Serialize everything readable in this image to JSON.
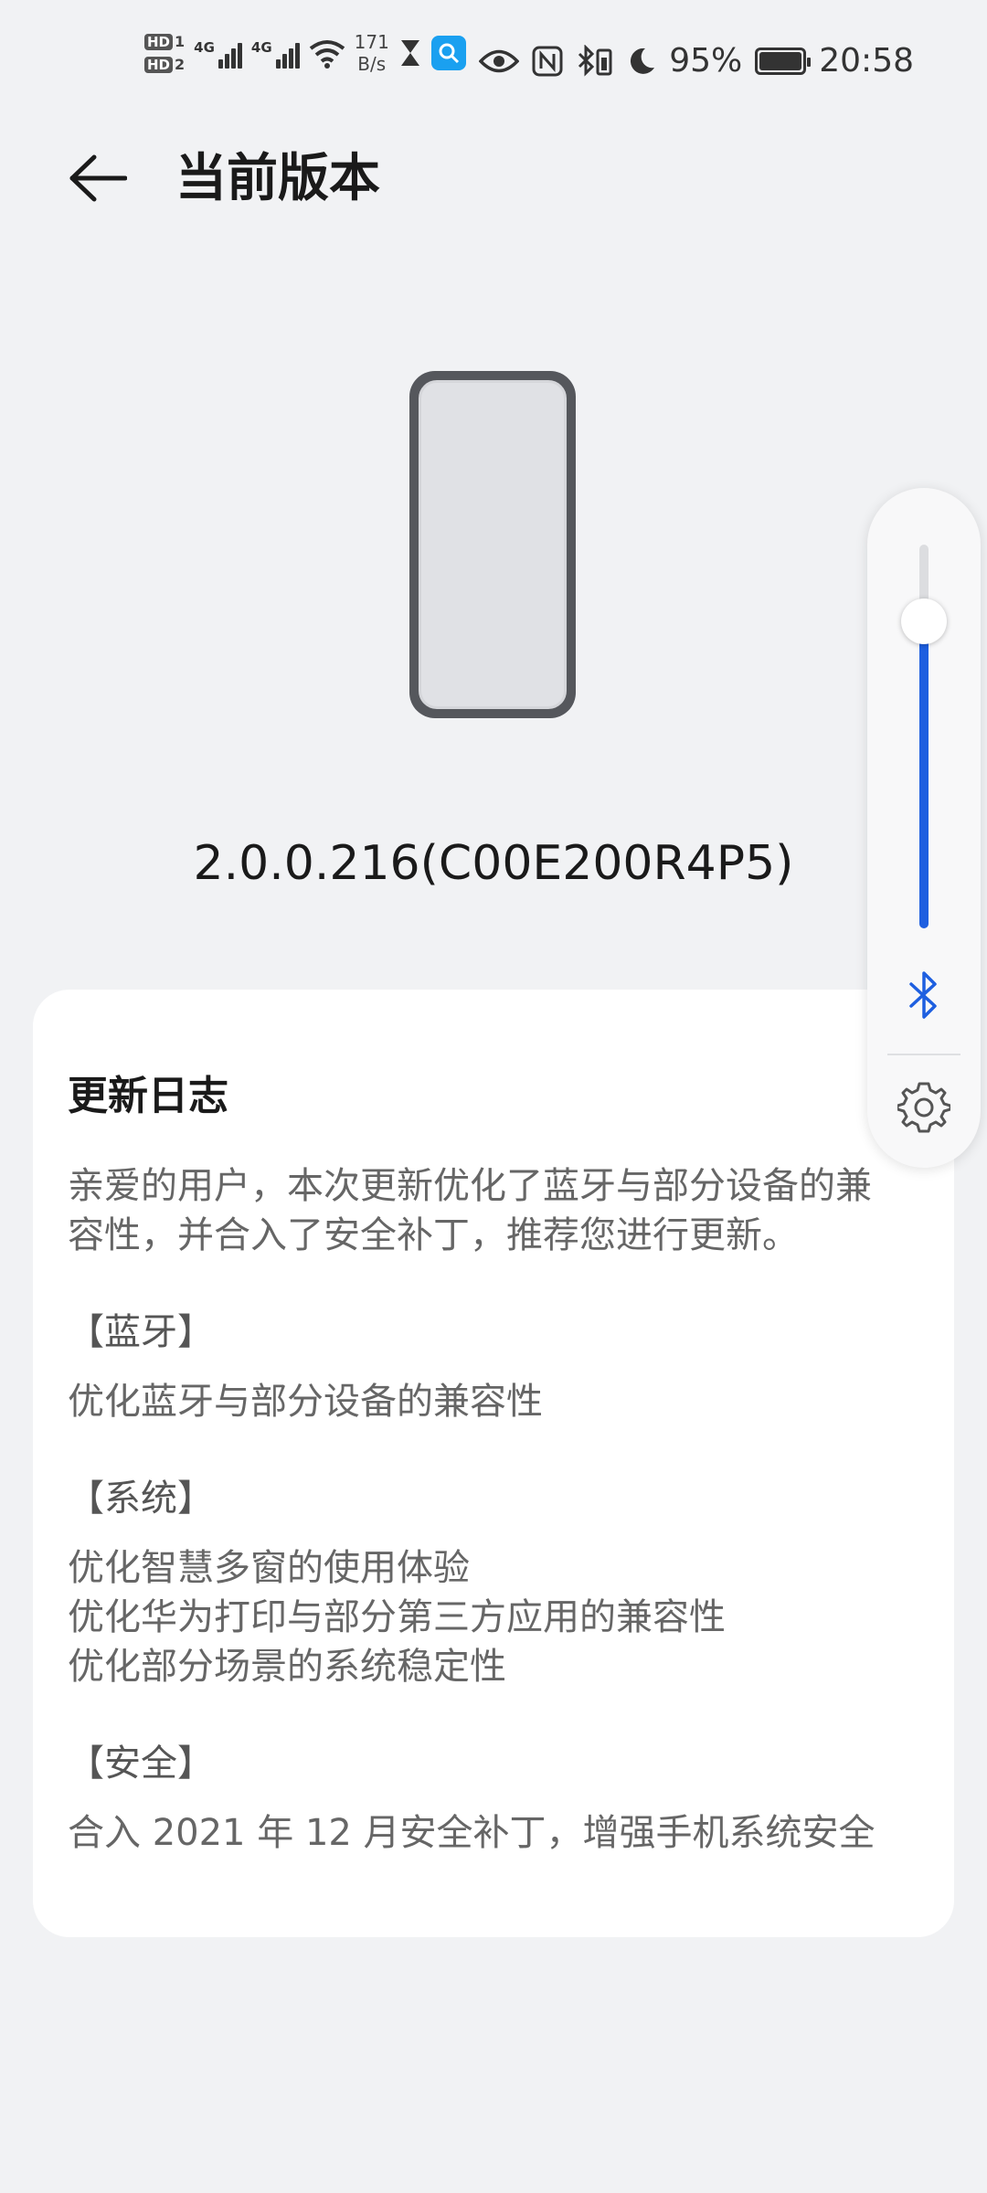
{
  "status_bar": {
    "sim1_label": "HD",
    "sim1_num": "1",
    "sim2_label": "HD",
    "sim2_num": "2",
    "network1": "4G",
    "network2": "4G",
    "speed_value": "171",
    "speed_unit": "B/s",
    "battery": "95%",
    "time": "20:58"
  },
  "header": {
    "title": "当前版本"
  },
  "version": "2.0.0.216(C00E200R4P5)",
  "changelog": {
    "title": "更新日志",
    "intro_lines": [
      "亲爱的用户，本次更新优化了蓝牙与部分设备的兼",
      "容性，并合入了安全补丁，推荐您进行更新。"
    ],
    "sections": [
      {
        "heading": "【蓝牙】",
        "items": [
          "优化蓝牙与部分设备的兼容性"
        ]
      },
      {
        "heading": "【系统】",
        "items": [
          "优化智慧多窗的使用体验",
          "优化华为打印与部分第三方应用的兼容性",
          "优化部分场景的系统稳定性"
        ]
      },
      {
        "heading": "【安全】",
        "items": [
          "合入 2021 年 12 月安全补丁，增强手机系统安全"
        ]
      }
    ]
  },
  "volume_panel": {
    "level": 0.8,
    "accent_color": "#1e5fe0",
    "icons": [
      "bluetooth-icon",
      "gear-icon"
    ]
  }
}
